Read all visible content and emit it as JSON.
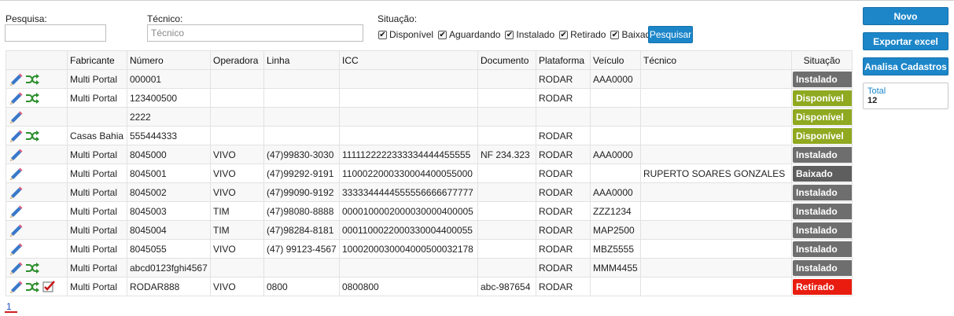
{
  "filters": {
    "search_label": "Pesquisa:",
    "search_value": "",
    "tech_label": "Técnico:",
    "tech_placeholder": "Técnico",
    "status_label": "Situação:",
    "status_options": [
      {
        "label": "Disponível",
        "checked": true
      },
      {
        "label": "Aguardando",
        "checked": true
      },
      {
        "label": "Instalado",
        "checked": true
      },
      {
        "label": "Retirado",
        "checked": true
      },
      {
        "label": "Baixado",
        "checked": true
      }
    ],
    "search_button": "Pesquisar"
  },
  "side": {
    "new_button": "Novo",
    "export_button": "Exportar excel",
    "analyze_button": "Analisa Cadastros",
    "total_label": "Total",
    "total_value": "12"
  },
  "colors": {
    "accent": "#1c86c9",
    "Instalado": "#6e6e6e",
    "Disponível": "#8fa920",
    "Baixado": "#5e5e5e",
    "Retirado": "#e81d10"
  },
  "table": {
    "headers": [
      "",
      "Fabricante",
      "Número",
      "Operadora",
      "Linha",
      "ICC",
      "Documento",
      "Plataforma",
      "Veículo",
      "Técnico",
      "Situação"
    ],
    "rows": [
      {
        "icons": [
          "edit-icon",
          "shuffle-icon"
        ],
        "fabricante": "Multi Portal",
        "numero": "000001",
        "operadora": "",
        "linha": "",
        "icc": "",
        "documento": "",
        "plataforma": "RODAR",
        "veiculo": "AAA0000",
        "tecnico": "",
        "situacao": "Instalado"
      },
      {
        "icons": [
          "edit-icon",
          "shuffle-icon"
        ],
        "fabricante": "Multi Portal",
        "numero": "123400500",
        "operadora": "",
        "linha": "",
        "icc": "",
        "documento": "",
        "plataforma": "RODAR",
        "veiculo": "",
        "tecnico": "",
        "situacao": "Disponível"
      },
      {
        "icons": [
          "edit-icon"
        ],
        "fabricante": "",
        "numero": "2222",
        "operadora": "",
        "linha": "",
        "icc": "",
        "documento": "",
        "plataforma": "",
        "veiculo": "",
        "tecnico": "",
        "situacao": "Disponível"
      },
      {
        "icons": [
          "edit-icon",
          "shuffle-icon"
        ],
        "fabricante": "Casas Bahia",
        "numero": "555444333",
        "operadora": "",
        "linha": "",
        "icc": "",
        "documento": "",
        "plataforma": "RODAR",
        "veiculo": "",
        "tecnico": "",
        "situacao": "Disponível"
      },
      {
        "icons": [
          "edit-icon"
        ],
        "fabricante": "Multi Portal",
        "numero": "8045000",
        "operadora": "VIVO",
        "linha": "(47)99830-3030",
        "icc": "1111122222333334444455555",
        "documento": "NF 234.323",
        "plataforma": "RODAR",
        "veiculo": "AAA0000",
        "tecnico": "",
        "situacao": "Instalado"
      },
      {
        "icons": [
          "edit-icon"
        ],
        "fabricante": "Multi Portal",
        "numero": "8045001",
        "operadora": "VIVO",
        "linha": "(47)99292-9191",
        "icc": "1100022000330004400055000",
        "documento": "",
        "plataforma": "RODAR",
        "veiculo": "",
        "tecnico": "RUPERTO SOARES GONZALES",
        "situacao": "Baixado"
      },
      {
        "icons": [
          "edit-icon"
        ],
        "fabricante": "Multi Portal",
        "numero": "8045002",
        "operadora": "VIVO",
        "linha": "(47)99090-9192",
        "icc": "3333344444555556666677777",
        "documento": "",
        "plataforma": "RODAR",
        "veiculo": "AAA0000",
        "tecnico": "",
        "situacao": "Instalado"
      },
      {
        "icons": [
          "edit-icon"
        ],
        "fabricante": "Multi Portal",
        "numero": "8045003",
        "operadora": "TIM",
        "linha": "(47)98080-8888",
        "icc": "0000100002000030000400005",
        "documento": "",
        "plataforma": "RODAR",
        "veiculo": "ZZZ1234",
        "tecnico": "",
        "situacao": "Instalado"
      },
      {
        "icons": [
          "edit-icon"
        ],
        "fabricante": "Multi Portal",
        "numero": "8045004",
        "operadora": "TIM",
        "linha": "(47)98284-8181",
        "icc": "0001100022000330004400055",
        "documento": "",
        "plataforma": "RODAR",
        "veiculo": "MAP2500",
        "tecnico": "",
        "situacao": "Instalado"
      },
      {
        "icons": [
          "edit-icon"
        ],
        "fabricante": "Multi Portal",
        "numero": "8045055",
        "operadora": "VIVO",
        "linha": "(47) 99123-4567",
        "icc": "1000200030004000500032178",
        "documento": "",
        "plataforma": "RODAR",
        "veiculo": "MBZ5555",
        "tecnico": "",
        "situacao": "Instalado"
      },
      {
        "icons": [
          "edit-icon",
          "shuffle-icon"
        ],
        "fabricante": "Multi Portal",
        "numero": "abcd0123fghi4567",
        "operadora": "",
        "linha": "",
        "icc": "",
        "documento": "",
        "plataforma": "RODAR",
        "veiculo": "MMM4455",
        "tecnico": "",
        "situacao": "Instalado"
      },
      {
        "icons": [
          "edit-icon",
          "shuffle-icon",
          "check-icon"
        ],
        "fabricante": "Multi Portal",
        "numero": "RODAR888",
        "operadora": "VIVO",
        "linha": "0800",
        "icc": "0800800",
        "documento": "abc-987654",
        "plataforma": "RODAR",
        "veiculo": "",
        "tecnico": "",
        "situacao": "Retirado"
      }
    ]
  },
  "pagination": {
    "current": "1"
  }
}
